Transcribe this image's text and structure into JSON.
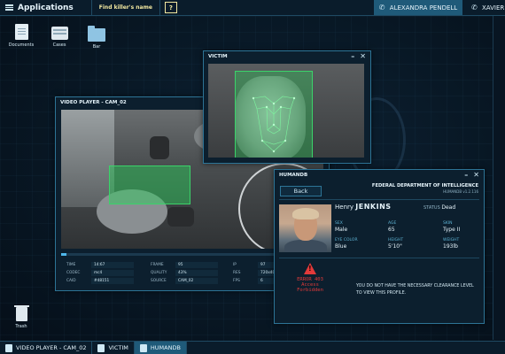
{
  "topbar": {
    "apps_label": "Applications",
    "find_label": "Find killer's name",
    "help_label": "?",
    "contacts": [
      {
        "name": "ALEXANDRA PENDELL",
        "active": true
      },
      {
        "name": "XAVIER",
        "active": false
      }
    ]
  },
  "desktop_icons": [
    {
      "label": "Documents",
      "icon": "document-icon"
    },
    {
      "label": "Cases",
      "icon": "cases-icon"
    },
    {
      "label": "Bar",
      "icon": "folder-icon"
    },
    {
      "label": "Trash",
      "icon": "trash-icon"
    }
  ],
  "video_player": {
    "title": "VIDEO PLAYER - CAM_02",
    "progress_fraction": 0.02,
    "meta": {
      "time_label": "TIME",
      "time": "14:67",
      "codec_label": "CODEC",
      "codec": "mc4",
      "caid_label": "CAID",
      "caid": "#48151",
      "frame_label": "FRAME",
      "frame": "95",
      "quality_label": "QUALITY",
      "quality": "43%",
      "source_label": "SOURCE",
      "source": "CAM_02",
      "ip_label": "IP",
      "ip": "97",
      "res_label": "RES",
      "res": "720x40",
      "fps_label": "FPS",
      "fps": "6"
    }
  },
  "victim": {
    "title": "VICTIM"
  },
  "humandb": {
    "title": "HUMANDB",
    "back_label": "Back",
    "agency": "FEDERAL DEPARTMENT OF INTELLIGENCE",
    "agency_sub": "HUMANDB v1.2.116",
    "first_name": "Henry",
    "last_name": "JENKINS",
    "status_label": "STATUS",
    "status": "Dead",
    "fields": {
      "sex_label": "SEX",
      "sex": "Male",
      "age_label": "AGE",
      "age": "65",
      "skin_label": "SKIN",
      "skin": "Type II",
      "eye_label": "EYE COLOR",
      "eye": "Blue",
      "height_label": "HEIGHT",
      "height": "5'10\"",
      "weight_label": "WEIGHT",
      "weight": "193lb"
    },
    "error_code": "ERROR 403",
    "error_text": "Access Forbidden",
    "clearance_msg": "YOU DO NOT HAVE THE NECESSARY CLEARANCE LEVEL TO VIEW THIS PROFILE."
  },
  "taskbar": {
    "items": [
      {
        "label": "VIDEO PLAYER - CAM_02",
        "active": false
      },
      {
        "label": "VICTIM",
        "active": false
      },
      {
        "label": "HUMANDB",
        "active": true
      }
    ]
  },
  "colors": {
    "accent": "#2d7496",
    "active_tab": "#1f5a79",
    "scan_green": "#3bd36a",
    "error_red": "#e23a3a"
  }
}
